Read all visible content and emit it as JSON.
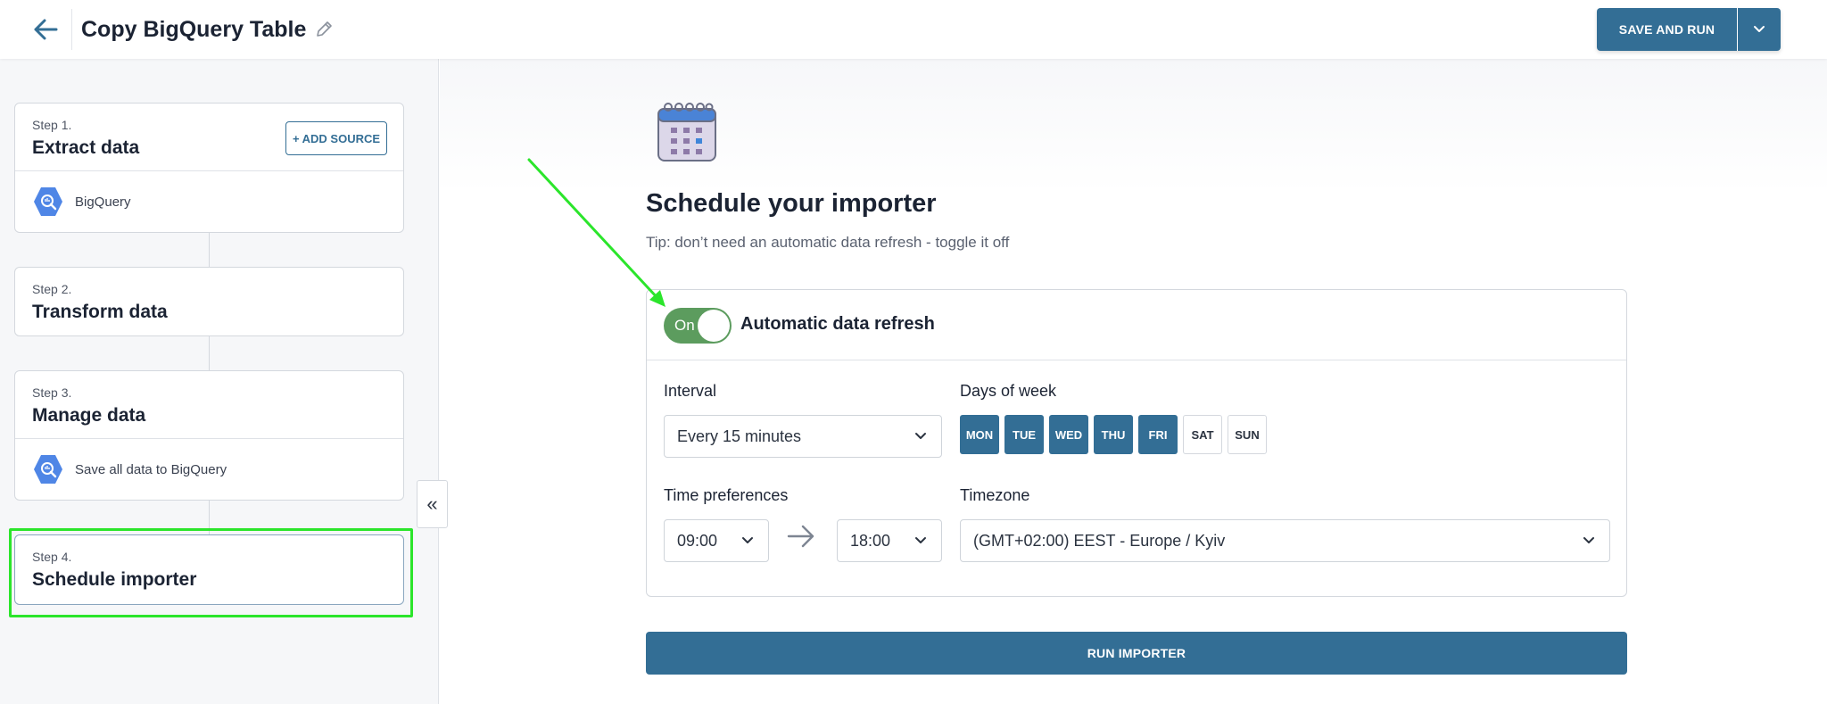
{
  "header": {
    "title": "Copy BigQuery Table",
    "save_label": "SAVE AND RUN"
  },
  "sidebar": {
    "collapse_glyph": "«",
    "steps": [
      {
        "num": "Step 1.",
        "title": "Extract data",
        "action_label": "+ ADD SOURCE",
        "item_label": "BigQuery"
      },
      {
        "num": "Step 2.",
        "title": "Transform data"
      },
      {
        "num": "Step 3.",
        "title": "Manage data",
        "item_label": "Save all data to BigQuery"
      },
      {
        "num": "Step 4.",
        "title": "Schedule importer",
        "active": true
      }
    ]
  },
  "main": {
    "title": "Schedule your importer",
    "tip": "Tip: don’t need an automatic data refresh - toggle it off",
    "toggle_label": "On",
    "refresh_label": "Automatic data refresh",
    "interval_label": "Interval",
    "interval_value": "Every 15 minutes",
    "days_label": "Days of week",
    "days": [
      {
        "label": "MON",
        "selected": true
      },
      {
        "label": "TUE",
        "selected": true
      },
      {
        "label": "WED",
        "selected": true
      },
      {
        "label": "THU",
        "selected": true
      },
      {
        "label": "FRI",
        "selected": true
      },
      {
        "label": "SAT",
        "selected": false
      },
      {
        "label": "SUN",
        "selected": false
      }
    ],
    "time_label": "Time preferences",
    "time_from": "09:00",
    "time_to": "18:00",
    "timezone_label": "Timezone",
    "timezone_value": "(GMT+02:00) EEST - Europe / Kyiv",
    "run_label": "RUN IMPORTER"
  },
  "colors": {
    "primary": "#336e95",
    "toggle_on": "#5c9c5e",
    "highlight": "#2be52b",
    "bigquery": "#4f86e6"
  }
}
